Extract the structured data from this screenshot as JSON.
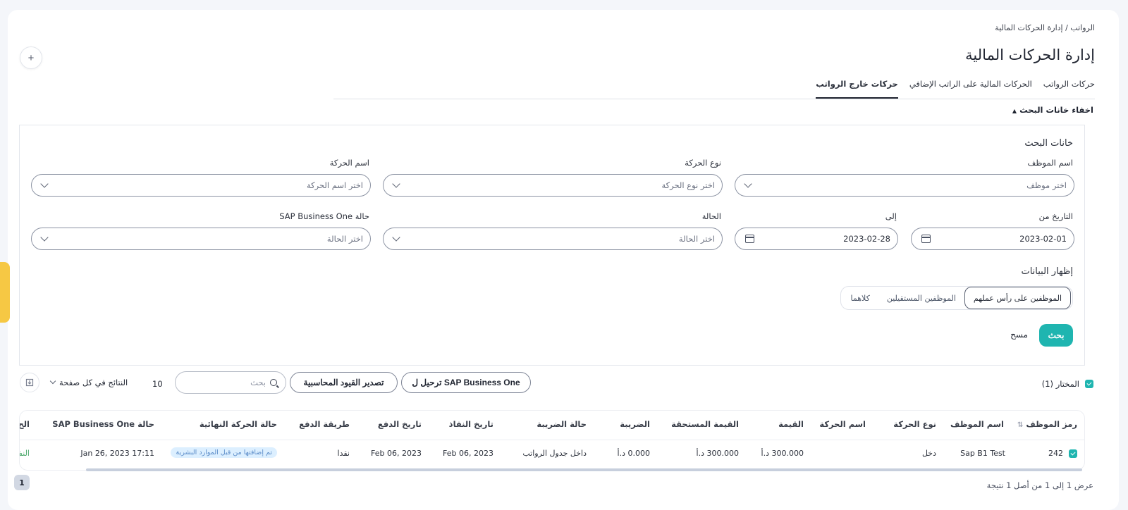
{
  "breadcrumb": "الرواتب / إدارة الحركات المالية",
  "page_title": "إدارة الحركات المالية",
  "add_icon": "+",
  "tabs": [
    {
      "label": "حركات الرواتب"
    },
    {
      "label": "الحركات المالية على الراتب الإضافي"
    },
    {
      "label": "حركات خارج الرواتب"
    }
  ],
  "hide_search_label": "اخفاء خانات البحث",
  "search": {
    "section_title": "خانات البحث",
    "employee_label": "اسم الموظف",
    "employee_placeholder": "اختر موظف",
    "movement_type_label": "نوع الحركة",
    "movement_type_placeholder": "اختر نوع الحركة",
    "movement_name_label": "اسم الحركة",
    "movement_name_placeholder": "اختر اسم الحركة",
    "date_from_label": "التاريخ من",
    "date_from_value": "2023-02-01",
    "date_to_label": "إلى",
    "date_to_value": "2023-02-28",
    "status_label": "الحالة",
    "status_placeholder": "اختر الحالة",
    "sap_status_label": "حالة SAP Business One",
    "sap_status_placeholder": "اختر الحالة",
    "display_title": "إظهار البيانات",
    "display_options": [
      "الموظفين على رأس عملهم",
      "الموظفين المستقيلين",
      "كلاهما"
    ],
    "display_selected": "الموظفين على رأس عملهم",
    "search_button": "بحث",
    "clear_button": "مسح"
  },
  "toolbar": {
    "selected_label": "المختار (1)",
    "post_sap_button": "ترحيل ل SAP Business One",
    "export_entries_button": "تصدير القيود المحاسبية",
    "search_placeholder": "بحث",
    "page_size": "10",
    "page_size_label": "النتائج في كل صفحة"
  },
  "table": {
    "headers": [
      "رمز الموظف",
      "اسم الموظف",
      "نوع الحركة",
      "اسم الحركة",
      "القيمة",
      "القيمة المستحقة",
      "الضريبة",
      "حالة الضريبة",
      "تاريخ النفاذ",
      "تاريخ الدفع",
      "طريقة الدفع",
      "حالة الحركة النهائية",
      "حالة SAP Business One",
      "الح"
    ],
    "rows": [
      [
        "242",
        "Sap B1 Test",
        "دخل",
        "",
        "300.000 د.أ",
        "300.000 د.أ",
        "0.000 د.أ",
        "داخل جدول الرواتب",
        "Feb 06, 2023",
        "Feb 06, 2023",
        "نقدا",
        "تم إضافتها من قبل الموارد البشرية",
        "Jan 26, 2023 17:11",
        "النف"
      ]
    ]
  },
  "pagination": {
    "current_page": "1",
    "summary": "عرض 1 إلى 1 من أصل 1 نتيجة"
  },
  "colors": {
    "accent": "#1fb5b0",
    "badge_bg": "#dcefff",
    "side_tab": "#f6c844"
  }
}
